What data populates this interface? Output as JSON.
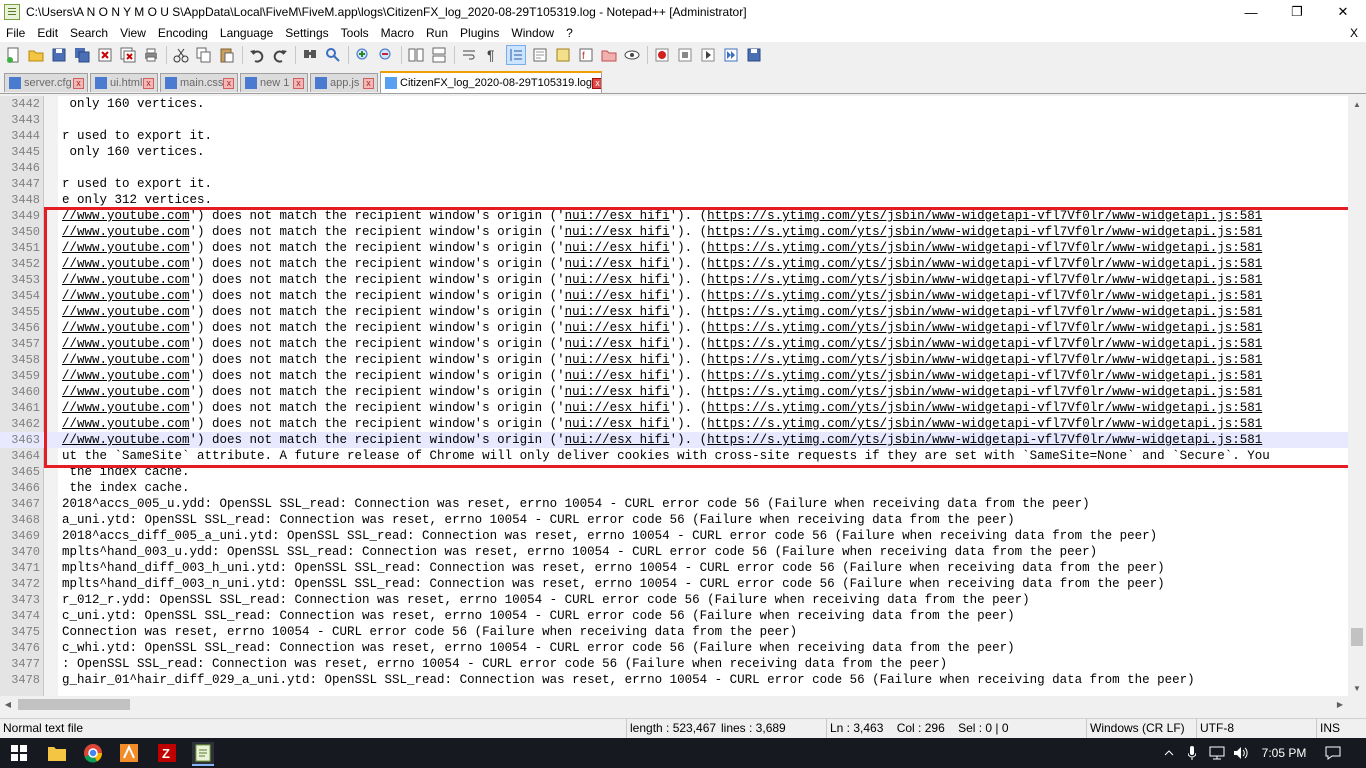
{
  "window": {
    "title": "C:\\Users\\A N O N Y M O U S\\AppData\\Local\\FiveM\\FiveM.app\\logs\\CitizenFX_log_2020-08-29T105319.log - Notepad++ [Administrator]",
    "min_glyph": "—",
    "max_glyph": "❐",
    "close_glyph": "✕"
  },
  "menu": {
    "items": [
      "File",
      "Edit",
      "Search",
      "View",
      "Encoding",
      "Language",
      "Settings",
      "Tools",
      "Macro",
      "Run",
      "Plugins",
      "Window",
      "?"
    ],
    "close_glyph": "X"
  },
  "tabs": [
    {
      "label": "server.cfg",
      "active": false
    },
    {
      "label": "ui.html",
      "active": false
    },
    {
      "label": "main.css",
      "active": false
    },
    {
      "label": "new 1",
      "active": false
    },
    {
      "label": "app.js",
      "active": false
    },
    {
      "label": "CitizenFX_log_2020-08-29T105319.log",
      "active": true
    }
  ],
  "editor": {
    "current_line": 3463,
    "lines": [
      {
        "num": "3442",
        "text": " only 160 vertices."
      },
      {
        "num": "3443",
        "text": ""
      },
      {
        "num": "3444",
        "text": "r used to export it."
      },
      {
        "num": "3445",
        "text": " only 160 vertices."
      },
      {
        "num": "3446",
        "text": ""
      },
      {
        "num": "3447",
        "text": "r used to export it."
      },
      {
        "num": "3448",
        "text": "e only 312 vertices."
      },
      {
        "num": "3449",
        "pre": "//www.youtube.com",
        "mid": "') does not match the recipient window's origin ('",
        "mid2": "nui://esx_hifi",
        "post": "'). (",
        "post2": "https://s.ytimg.com/yts/jsbin/www-widgetapi-vfl7Vf0lr/www-widgetapi.js:581"
      },
      {
        "num": "3450",
        "pre": "//www.youtube.com",
        "mid": "') does not match the recipient window's origin ('",
        "mid2": "nui://esx_hifi",
        "post": "'). (",
        "post2": "https://s.ytimg.com/yts/jsbin/www-widgetapi-vfl7Vf0lr/www-widgetapi.js:581"
      },
      {
        "num": "3451",
        "pre": "//www.youtube.com",
        "mid": "') does not match the recipient window's origin ('",
        "mid2": "nui://esx_hifi",
        "post": "'). (",
        "post2": "https://s.ytimg.com/yts/jsbin/www-widgetapi-vfl7Vf0lr/www-widgetapi.js:581"
      },
      {
        "num": "3452",
        "pre": "//www.youtube.com",
        "mid": "') does not match the recipient window's origin ('",
        "mid2": "nui://esx_hifi",
        "post": "'). (",
        "post2": "https://s.ytimg.com/yts/jsbin/www-widgetapi-vfl7Vf0lr/www-widgetapi.js:581"
      },
      {
        "num": "3453",
        "pre": "//www.youtube.com",
        "mid": "') does not match the recipient window's origin ('",
        "mid2": "nui://esx_hifi",
        "post": "'). (",
        "post2": "https://s.ytimg.com/yts/jsbin/www-widgetapi-vfl7Vf0lr/www-widgetapi.js:581"
      },
      {
        "num": "3454",
        "pre": "//www.youtube.com",
        "mid": "') does not match the recipient window's origin ('",
        "mid2": "nui://esx_hifi",
        "post": "'). (",
        "post2": "https://s.ytimg.com/yts/jsbin/www-widgetapi-vfl7Vf0lr/www-widgetapi.js:581"
      },
      {
        "num": "3455",
        "pre": "//www.youtube.com",
        "mid": "') does not match the recipient window's origin ('",
        "mid2": "nui://esx_hifi",
        "post": "'). (",
        "post2": "https://s.ytimg.com/yts/jsbin/www-widgetapi-vfl7Vf0lr/www-widgetapi.js:581"
      },
      {
        "num": "3456",
        "pre": "//www.youtube.com",
        "mid": "') does not match the recipient window's origin ('",
        "mid2": "nui://esx_hifi",
        "post": "'). (",
        "post2": "https://s.ytimg.com/yts/jsbin/www-widgetapi-vfl7Vf0lr/www-widgetapi.js:581"
      },
      {
        "num": "3457",
        "pre": "//www.youtube.com",
        "mid": "') does not match the recipient window's origin ('",
        "mid2": "nui://esx_hifi",
        "post": "'). (",
        "post2": "https://s.ytimg.com/yts/jsbin/www-widgetapi-vfl7Vf0lr/www-widgetapi.js:581"
      },
      {
        "num": "3458",
        "pre": "//www.youtube.com",
        "mid": "') does not match the recipient window's origin ('",
        "mid2": "nui://esx_hifi",
        "post": "'). (",
        "post2": "https://s.ytimg.com/yts/jsbin/www-widgetapi-vfl7Vf0lr/www-widgetapi.js:581"
      },
      {
        "num": "3459",
        "pre": "//www.youtube.com",
        "mid": "') does not match the recipient window's origin ('",
        "mid2": "nui://esx_hifi",
        "post": "'). (",
        "post2": "https://s.ytimg.com/yts/jsbin/www-widgetapi-vfl7Vf0lr/www-widgetapi.js:581"
      },
      {
        "num": "3460",
        "pre": "//www.youtube.com",
        "mid": "') does not match the recipient window's origin ('",
        "mid2": "nui://esx_hifi",
        "post": "'). (",
        "post2": "https://s.ytimg.com/yts/jsbin/www-widgetapi-vfl7Vf0lr/www-widgetapi.js:581"
      },
      {
        "num": "3461",
        "pre": "//www.youtube.com",
        "mid": "') does not match the recipient window's origin ('",
        "mid2": "nui://esx_hifi",
        "post": "'). (",
        "post2": "https://s.ytimg.com/yts/jsbin/www-widgetapi-vfl7Vf0lr/www-widgetapi.js:581"
      },
      {
        "num": "3462",
        "pre": "//www.youtube.com",
        "mid": "') does not match the recipient window's origin ('",
        "mid2": "nui://esx_hifi",
        "post": "'). (",
        "post2": "https://s.ytimg.com/yts/jsbin/www-widgetapi-vfl7Vf0lr/www-widgetapi.js:581"
      },
      {
        "num": "3463",
        "pre": "//www.youtube.com",
        "mid": "') does not match the recipient window's origin ('",
        "mid2": "nui://esx_hifi",
        "post": "'). (",
        "post2": "https://s.ytimg.com/yts/jsbin/www-widgetapi-vfl7Vf0lr/www-widgetapi.js:581"
      },
      {
        "num": "3464",
        "text": "ut the `SameSite` attribute. A future release of Chrome will only deliver cookies with cross-site requests if they are set with `SameSite=None` and `Secure`. You"
      },
      {
        "num": "3465",
        "text": " the index cache."
      },
      {
        "num": "3466",
        "text": " the index cache."
      },
      {
        "num": "3467",
        "text": "2018^accs_005_u.ydd: OpenSSL SSL_read: Connection was reset, errno 10054 - CURL error code 56 (Failure when receiving data from the peer)"
      },
      {
        "num": "3468",
        "text": "a_uni.ytd: OpenSSL SSL_read: Connection was reset, errno 10054 - CURL error code 56 (Failure when receiving data from the peer)"
      },
      {
        "num": "3469",
        "text": "2018^accs_diff_005_a_uni.ytd: OpenSSL SSL_read: Connection was reset, errno 10054 - CURL error code 56 (Failure when receiving data from the peer)"
      },
      {
        "num": "3470",
        "text": "mplts^hand_003_u.ydd: OpenSSL SSL_read: Connection was reset, errno 10054 - CURL error code 56 (Failure when receiving data from the peer)"
      },
      {
        "num": "3471",
        "text": "mplts^hand_diff_003_h_uni.ytd: OpenSSL SSL_read: Connection was reset, errno 10054 - CURL error code 56 (Failure when receiving data from the peer)"
      },
      {
        "num": "3472",
        "text": "mplts^hand_diff_003_n_uni.ytd: OpenSSL SSL_read: Connection was reset, errno 10054 - CURL error code 56 (Failure when receiving data from the peer)"
      },
      {
        "num": "3473",
        "text": "r_012_r.ydd: OpenSSL SSL_read: Connection was reset, errno 10054 - CURL error code 56 (Failure when receiving data from the peer)"
      },
      {
        "num": "3474",
        "text": "c_uni.ytd: OpenSSL SSL_read: Connection was reset, errno 10054 - CURL error code 56 (Failure when receiving data from the peer)"
      },
      {
        "num": "3475",
        "text": "Connection was reset, errno 10054 - CURL error code 56 (Failure when receiving data from the peer)"
      },
      {
        "num": "3476",
        "text": "c_whi.ytd: OpenSSL SSL_read: Connection was reset, errno 10054 - CURL error code 56 (Failure when receiving data from the peer)"
      },
      {
        "num": "3477",
        "text": ": OpenSSL SSL_read: Connection was reset, errno 10054 - CURL error code 56 (Failure when receiving data from the peer)"
      },
      {
        "num": "3478",
        "text": "g_hair_01^hair_diff_029_a_uni.ytd: OpenSSL SSL_read: Connection was reset, errno 10054 - CURL error code 56 (Failure when receiving data from the peer)"
      }
    ]
  },
  "status": {
    "file_type": "Normal text file",
    "length": "length : 523,467",
    "lines": "lines : 3,689",
    "position": "Ln : 3,463    Col : 296    Sel : 0 | 0",
    "eol": "Windows (CR LF)",
    "encoding": "UTF-8",
    "mode": "INS"
  },
  "taskbar": {
    "time": "7:05 PM"
  },
  "colors": {
    "highlight_border": "#e51c23",
    "active_tab_accent": "#f0a000",
    "taskbar_bg": "#16191f"
  }
}
